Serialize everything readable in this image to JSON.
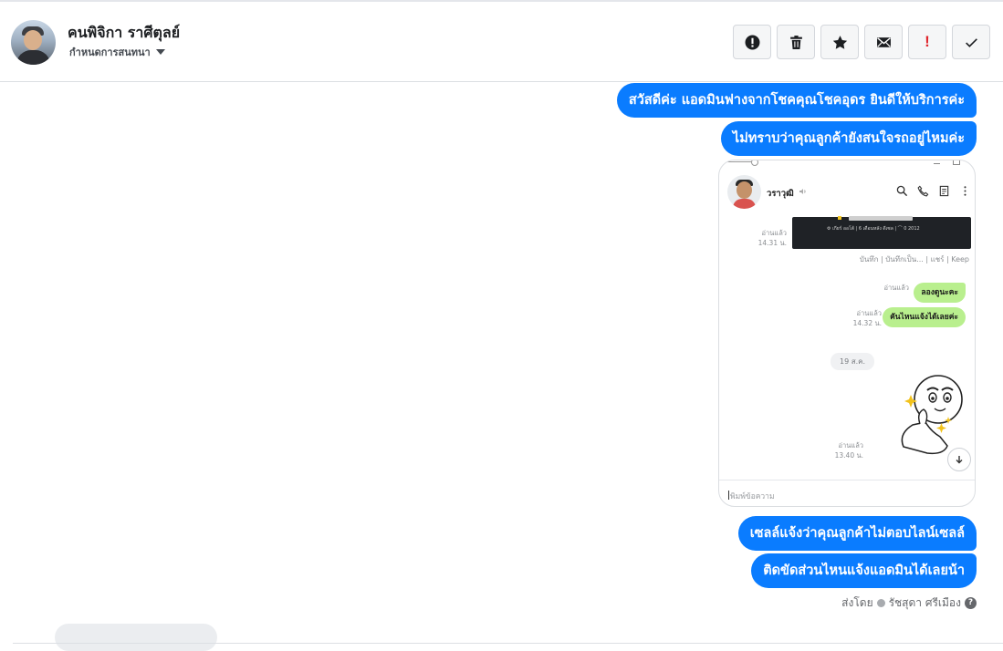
{
  "contact": {
    "name": "คนพิจิกา ราศีตุลย์",
    "label_dropdown": "กำหนดการสนทนา"
  },
  "toolbar": {
    "buttons": [
      {
        "name": "report-button",
        "icon": "alert-circle-icon"
      },
      {
        "name": "delete-button",
        "icon": "trash-icon"
      },
      {
        "name": "star-button",
        "icon": "star-icon"
      },
      {
        "name": "mark-unread-button",
        "icon": "envelope-icon"
      },
      {
        "name": "important-button",
        "icon": "exclamation-icon",
        "glyph": "!"
      },
      {
        "name": "done-button",
        "icon": "checkmark-icon"
      }
    ]
  },
  "messages": {
    "m1": "สวัสดีค่ะ แอดมินฟางจากโชคคุณโชคอุดร ยินดีให้บริการค่ะ",
    "m2": "ไม่ทราบว่าคุณลูกค้ายังสนใจรถอยู่ไหมค่ะ",
    "m3": "เซลล์แจ้งว่าคุณลูกค้าไม่ตอบไลน์เซลล์",
    "m4": "ติดขัดส่วนไหนแจ้งแอดมินได้เลยน้า"
  },
  "attachment": {
    "chat_name": "วราวุฒิ",
    "read_label": "อ่านแล้ว",
    "time_1": "14.31 น.",
    "save_links": "บันทึก | บันทึกเป็น... | แชร์ | Keep",
    "card_caption": "⚙ เกียร์ ออโต้  |  6 เดือนหลัง ดีเซล  |  ⌒ 0 2012",
    "green_1": "ลองดูนะคะ",
    "green_2": "คันไหนแจ้งได้เลยค่ะ",
    "time_2": "14.32 น.",
    "date_divider": "19 ส.ค.",
    "time_3": "13.40 น.",
    "input_placeholder": "พิมพ์ข้อความ"
  },
  "footer": {
    "sent_by_label": "ส่งโดย",
    "sender": "รัชสุดา ศรีเมือง",
    "help_glyph": "?"
  },
  "colors": {
    "bubble_blue": "#0a7cff",
    "line_green": "#b9ef8e",
    "important_red": "#e0262d"
  }
}
